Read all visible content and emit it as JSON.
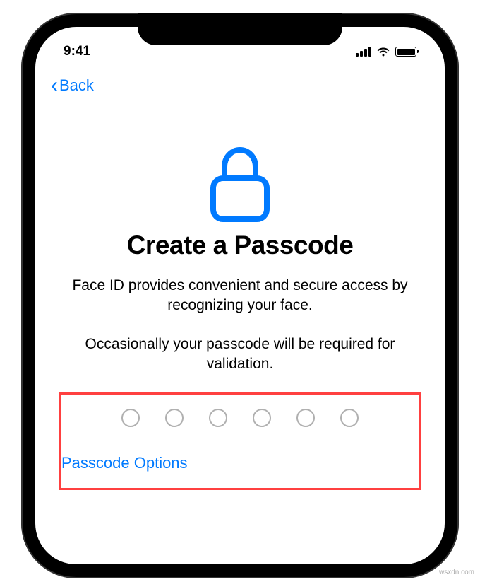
{
  "status": {
    "time": "9:41"
  },
  "nav": {
    "back_label": "Back"
  },
  "content": {
    "title": "Create a Passcode",
    "subtitle1": "Face ID provides convenient and secure access by recognizing your face.",
    "subtitle2": "Occasionally your passcode will be required for validation."
  },
  "passcode": {
    "digit_count": 6,
    "options_label": "Passcode Options"
  },
  "watermark": "wsxdn.com"
}
